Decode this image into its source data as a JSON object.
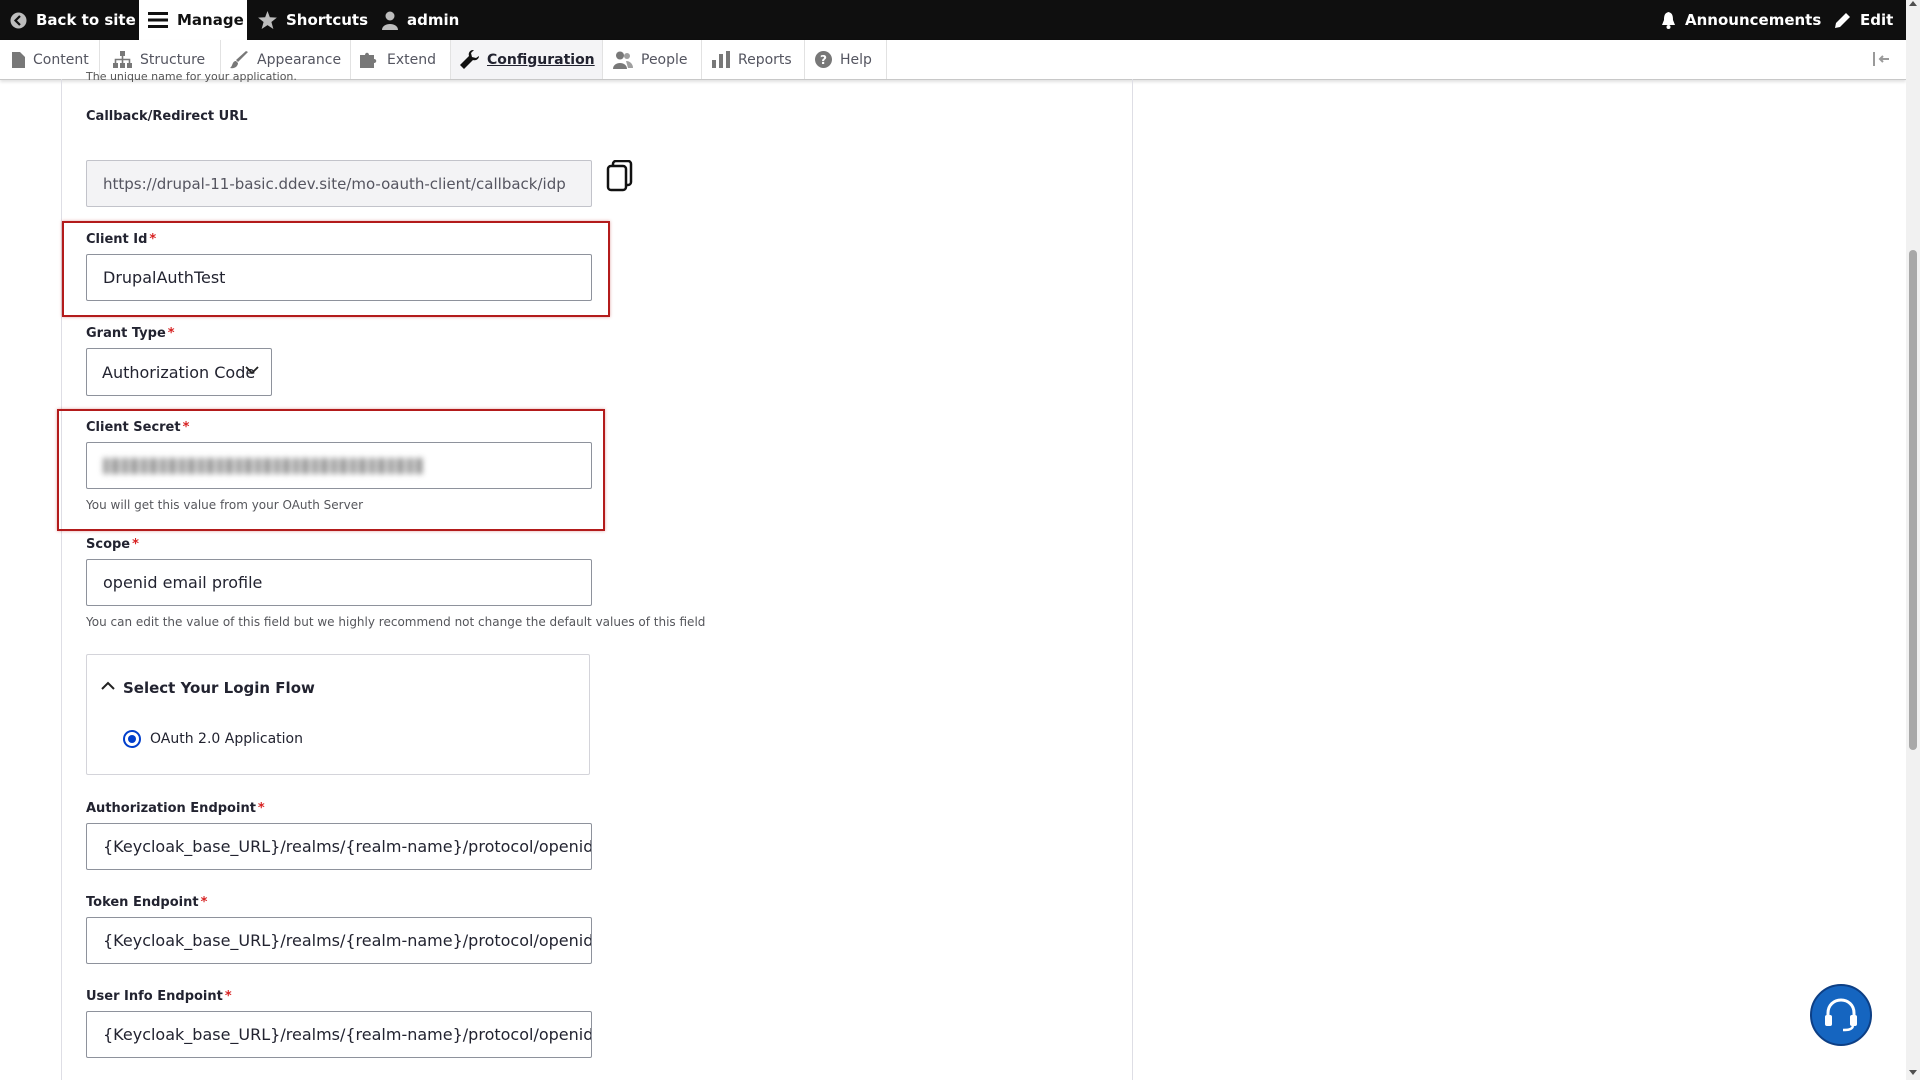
{
  "toolbar": {
    "back_to_site": "Back to site",
    "manage": "Manage",
    "shortcuts": "Shortcuts",
    "user": "admin",
    "announcements": "Announcements",
    "edit": "Edit"
  },
  "tray": {
    "items": [
      {
        "label": "Content"
      },
      {
        "label": "Structure"
      },
      {
        "label": "Appearance"
      },
      {
        "label": "Extend"
      },
      {
        "label": "Configuration"
      },
      {
        "label": "People"
      },
      {
        "label": "Reports"
      },
      {
        "label": "Help"
      }
    ],
    "active": "Configuration"
  },
  "form": {
    "cut_description": "The unique name for your application.",
    "callback": {
      "label": "Callback/Redirect URL",
      "value": "https://drupal-11-basic.ddev.site/mo-oauth-client/callback/idp"
    },
    "client_id": {
      "label": "Client Id",
      "required": "*",
      "value": "DrupalAuthTest"
    },
    "grant_type": {
      "label": "Grant Type",
      "required": "*",
      "value": "Authorization Code"
    },
    "client_secret": {
      "label": "Client Secret",
      "required": "*",
      "description": "You will get this value from your OAuth Server"
    },
    "scope": {
      "label": "Scope",
      "required": "*",
      "value": "openid email profile",
      "description": "You can edit the value of this field but we highly recommend not change the default values of this field"
    },
    "login_flow": {
      "title": "Select Your Login Flow",
      "option": "OAuth 2.0 Application"
    },
    "authorization_endpoint": {
      "label": "Authorization Endpoint",
      "required": "*",
      "value": "{Keycloak_base_URL}/realms/{realm-name}/protocol/openid-connect/auth"
    },
    "token_endpoint": {
      "label": "Token Endpoint",
      "required": "*",
      "value": "{Keycloak_base_URL}/realms/{realm-name}/protocol/openid-connect/token"
    },
    "user_info_endpoint": {
      "label": "User Info Endpoint",
      "required": "*",
      "value": "{Keycloak_base_URL}/realms/{realm-name}/protocol/openid-connect/userinfo"
    }
  },
  "colors": {
    "highlight": "#b31b1b",
    "accent": "#003ecc",
    "help_button": "#1565c0"
  }
}
